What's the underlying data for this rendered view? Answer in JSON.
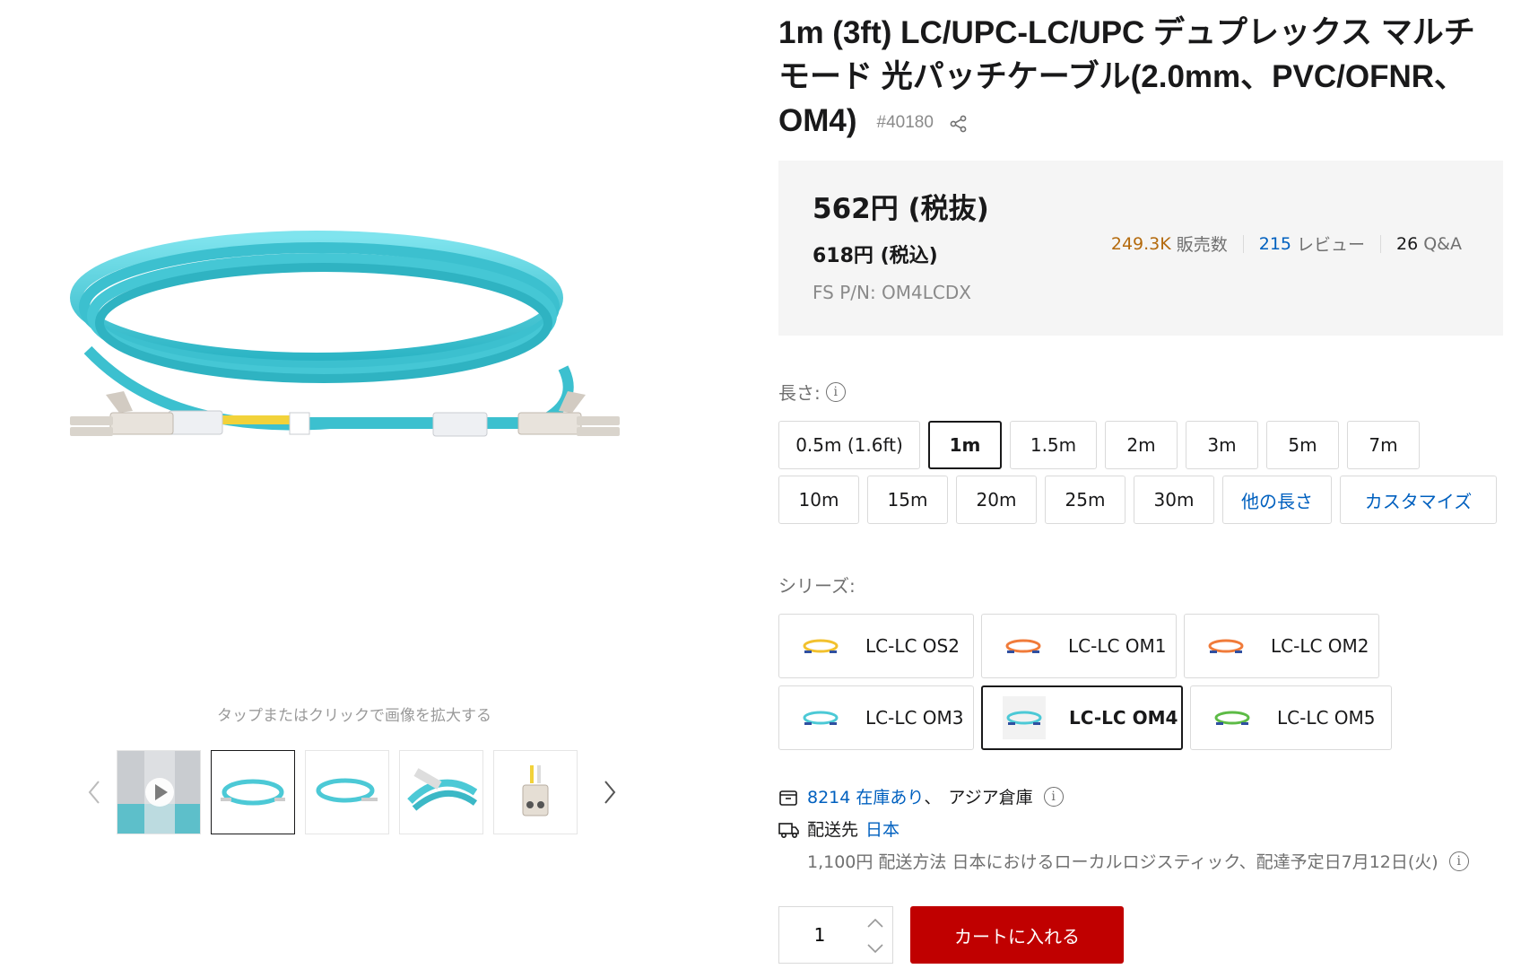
{
  "product": {
    "title": "1m (3ft) LC/UPC-LC/UPC デュプレックス マルチモード 光パッチケーブル(2.0mm、PVC/OFNR、OM4)",
    "id": "#40180"
  },
  "gallery": {
    "zoom_hint": "タップまたはクリックで画像を拡大する",
    "thumbnails": [
      "video",
      "coil-aqua",
      "coil-aqua-small",
      "connector-closeup",
      "duplex-connector"
    ]
  },
  "price": {
    "excl": "562円 (税抜)",
    "incl": "618円 (税込)",
    "pn": "FS P/N: OM4LCDX"
  },
  "stats": {
    "sold_num": "249.3K",
    "sold_label": "販売数",
    "reviews_num": "215",
    "reviews_label": "レビュー",
    "qa_num": "26",
    "qa_label": "Q&A"
  },
  "length": {
    "label": "長さ:",
    "options": [
      {
        "label": "0.5m (1.6ft)",
        "w": 150
      },
      {
        "label": "1m",
        "w": 74
      },
      {
        "label": "1.5m",
        "w": 89
      },
      {
        "label": "2m",
        "w": 73
      },
      {
        "label": "3m",
        "w": 73
      },
      {
        "label": "5m",
        "w": 73
      },
      {
        "label": "7m",
        "w": 73
      },
      {
        "label": "10m",
        "w": 82
      },
      {
        "label": "15m",
        "w": 82
      },
      {
        "label": "20m",
        "w": 82
      },
      {
        "label": "25m",
        "w": 82
      },
      {
        "label": "30m",
        "w": 82
      },
      {
        "label": "他の長さ",
        "w": 114
      },
      {
        "label": "カスタマイズ",
        "w": 167
      }
    ],
    "selected": "1m",
    "link_options": [
      "他の長さ",
      "カスタマイズ"
    ]
  },
  "series": {
    "label": "シリーズ:",
    "options": [
      {
        "label": "LC-LC OS2",
        "color": "#f2c12e"
      },
      {
        "label": "LC-LC OM1",
        "color": "#f07b3a"
      },
      {
        "label": "LC-LC OM2",
        "color": "#f07b3a"
      },
      {
        "label": "LC-LC OM3",
        "color": "#4cc9d6"
      },
      {
        "label": "LC-LC OM4",
        "color": "#4cc9d6"
      },
      {
        "label": "LC-LC OM5",
        "color": "#5dbb46"
      }
    ],
    "selected": "LC-LC OM4"
  },
  "stock": {
    "count": "8214 在庫あり",
    "sep": "、",
    "warehouse": "アジア倉庫",
    "ship_label": "配送先",
    "ship_country": "日本",
    "ship_detail": "1,100円 配送方法 日本におけるローカルロジスティック、配達予定日7月12日(火)"
  },
  "cart": {
    "qty": "1",
    "button": "カートに入れる"
  },
  "colors": {
    "accent_red": "#c00000",
    "link_blue": "#0060bf",
    "cable_aqua": "#4cc9d6"
  }
}
